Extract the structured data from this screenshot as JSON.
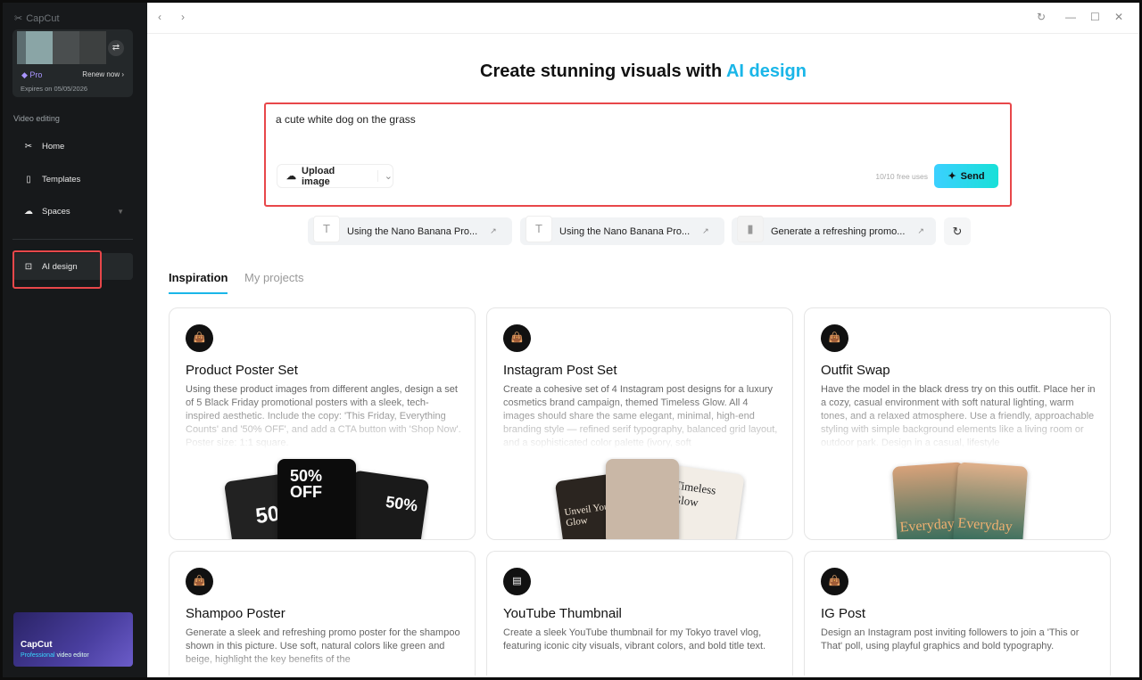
{
  "sidebar": {
    "logo": "CapCut",
    "plan": "Pro",
    "renew": "Renew now",
    "expires": "Expires on 05/05/2026",
    "section": "Video editing",
    "items": [
      {
        "label": "Home"
      },
      {
        "label": "Templates"
      },
      {
        "label": "Spaces"
      },
      {
        "label": "AI design"
      }
    ],
    "promo": {
      "title": "CapCut",
      "subtitle_accent": "Professional",
      "subtitle_rest": " video editor"
    }
  },
  "headline": {
    "main": "Create stunning visuals with ",
    "accent": "AI design"
  },
  "prompt": {
    "value": "a cute white dog on the grass",
    "upload": "Upload image",
    "free_uses": "10/10 free uses",
    "send": "Send"
  },
  "suggestions": [
    {
      "label": "Using the Nano Banana Pro..."
    },
    {
      "label": "Using the Nano Banana Pro..."
    },
    {
      "label": "Generate a refreshing promo..."
    }
  ],
  "tabs": [
    "Inspiration",
    "My projects"
  ],
  "cards": [
    {
      "title": "Product Poster Set",
      "desc": "Using these product images from different angles, design a set of 5 Black Friday promotional posters with a sleek, tech-inspired aesthetic. Include the copy: 'This Friday, Everything Counts' and '50% OFF', and add a CTA button with 'Shop Now'. Poster size: 1:1 square."
    },
    {
      "title": "Instagram Post Set",
      "desc": "Create a cohesive set of 4 Instagram post designs for a luxury cosmetics brand campaign, themed Timeless Glow. All 4 images should share the same elegant, minimal, high-end branding style — refined serif typography, balanced grid layout, and a sophisticated color palette (ivory, soft"
    },
    {
      "title": "Outfit Swap",
      "desc": "Have the model in the black dress try on this outfit. Place her in a cozy, casual environment with soft natural lighting, warm tones, and a relaxed atmosphere. Use a friendly, approachable styling with simple background elements like a living room or outdoor park. Design in a casual, lifestyle"
    },
    {
      "title": "Shampoo Poster",
      "desc": "Generate a sleek and refreshing promo poster for the shampoo shown in this picture. Use soft, natural colors like green and beige, highlight the key benefits of the"
    },
    {
      "title": "YouTube Thumbnail",
      "desc": "Create a sleek YouTube thumbnail for my Tokyo travel vlog, featuring iconic city visuals, vibrant colors, and bold title text."
    },
    {
      "title": "IG Post",
      "desc": "Design an Instagram post inviting followers to join a 'This or That' poll, using playful graphics and bold typography."
    }
  ],
  "art": {
    "p1a": "50",
    "p1b": "50%",
    "p1c": "OFF",
    "p2a": "Unveil Your Glow",
    "p2b": "Timeless Glow",
    "p3": "Everyday"
  }
}
